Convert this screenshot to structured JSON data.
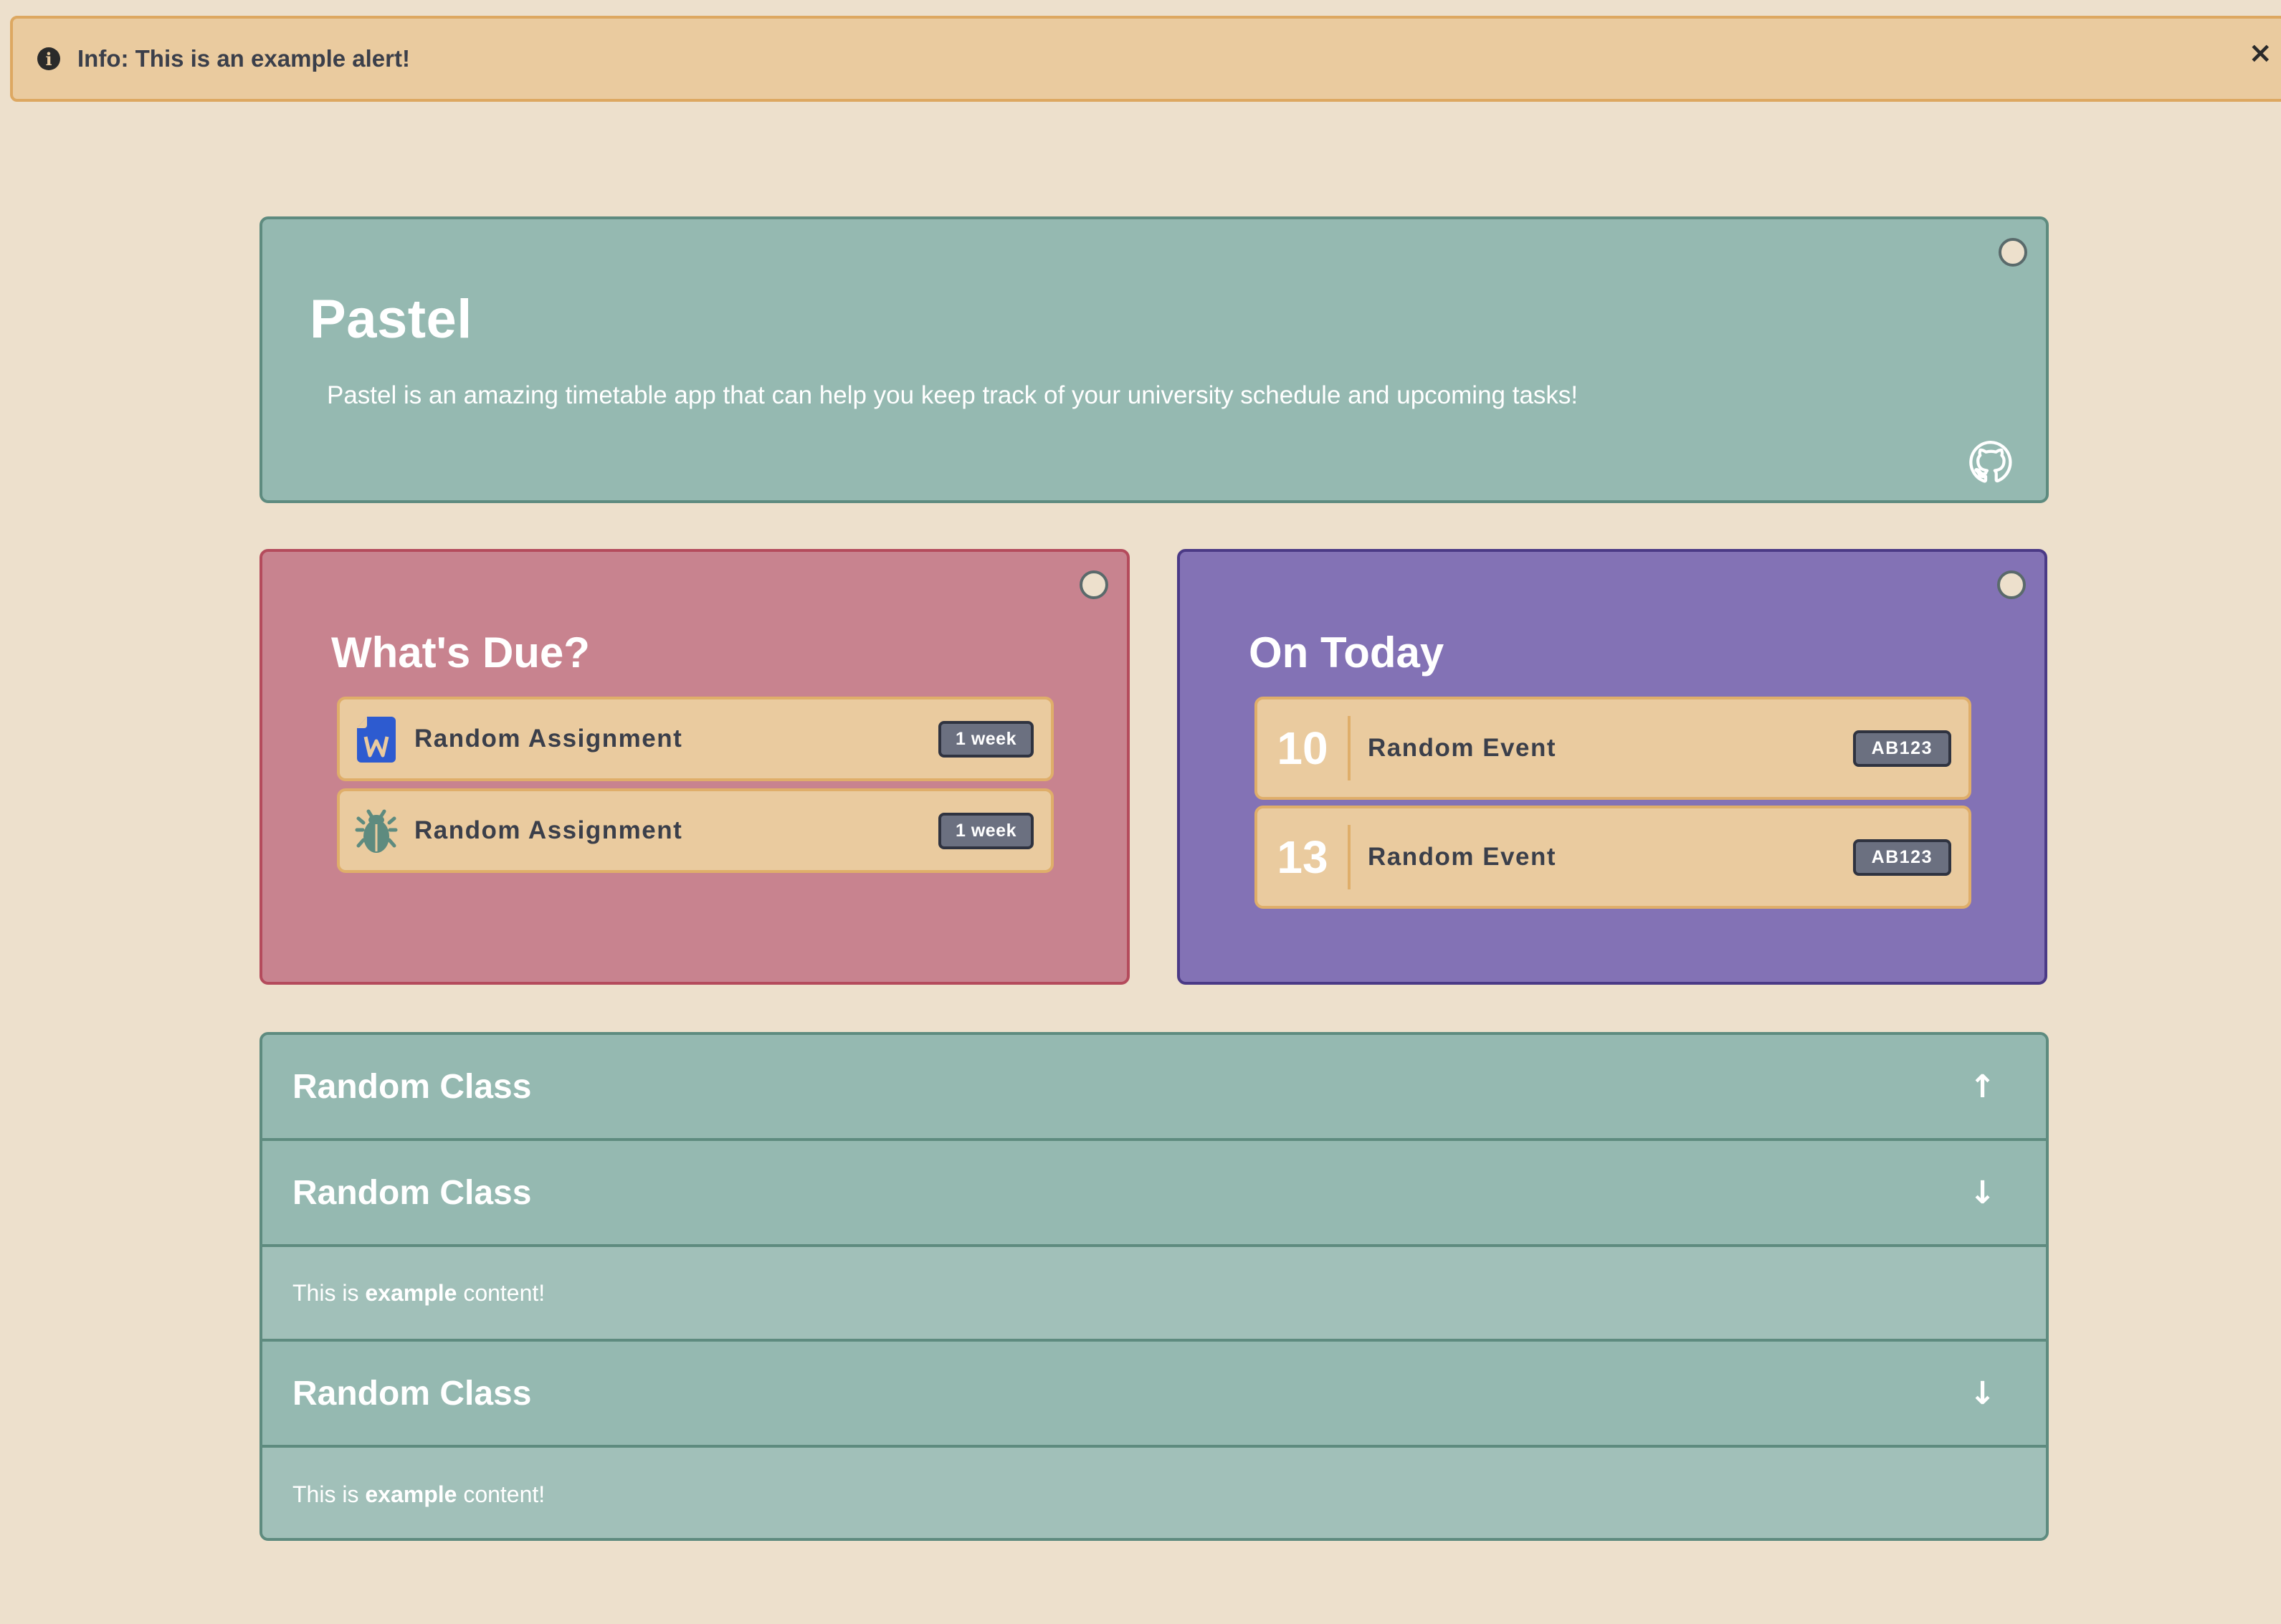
{
  "alert": {
    "prefix": "Info: This is an ",
    "strong": "example",
    "suffix": " alert!",
    "close": "×"
  },
  "hero": {
    "title": "Pastel",
    "description": "Pastel is an amazing timetable app that can help you keep track of your university schedule and upcoming tasks!",
    "github_icon": "github-icon"
  },
  "due": {
    "title": "What's Due?",
    "items": [
      {
        "icon": "word-document-icon",
        "label": "Random Assignment",
        "badge": "1 week"
      },
      {
        "icon": "bug-icon",
        "label": "Random Assignment",
        "badge": "1 week"
      }
    ]
  },
  "today": {
    "title": "On Today",
    "items": [
      {
        "day": "10",
        "label": "Random Event",
        "badge": "AB123"
      },
      {
        "day": "13",
        "label": "Random Event",
        "badge": "AB123"
      }
    ]
  },
  "accordion": {
    "sections": [
      {
        "title": "Random Class",
        "arrow": "↑",
        "expanded": false
      },
      {
        "title": "Random Class",
        "arrow": "↓",
        "expanded": true,
        "content_prefix": "This is ",
        "content_strong": "example",
        "content_suffix": " content!"
      },
      {
        "title": "Random Class",
        "arrow": "↓",
        "expanded": true,
        "content_prefix": "This is ",
        "content_strong": "example",
        "content_suffix": " content!"
      }
    ]
  },
  "colors": {
    "background": "#ede0cc",
    "alert": "#eacb9f",
    "teal": "#95b9b1",
    "rose": "#c8838f",
    "purple": "#8372b5",
    "item": "#eacb9f",
    "badge": "#6b7080"
  }
}
